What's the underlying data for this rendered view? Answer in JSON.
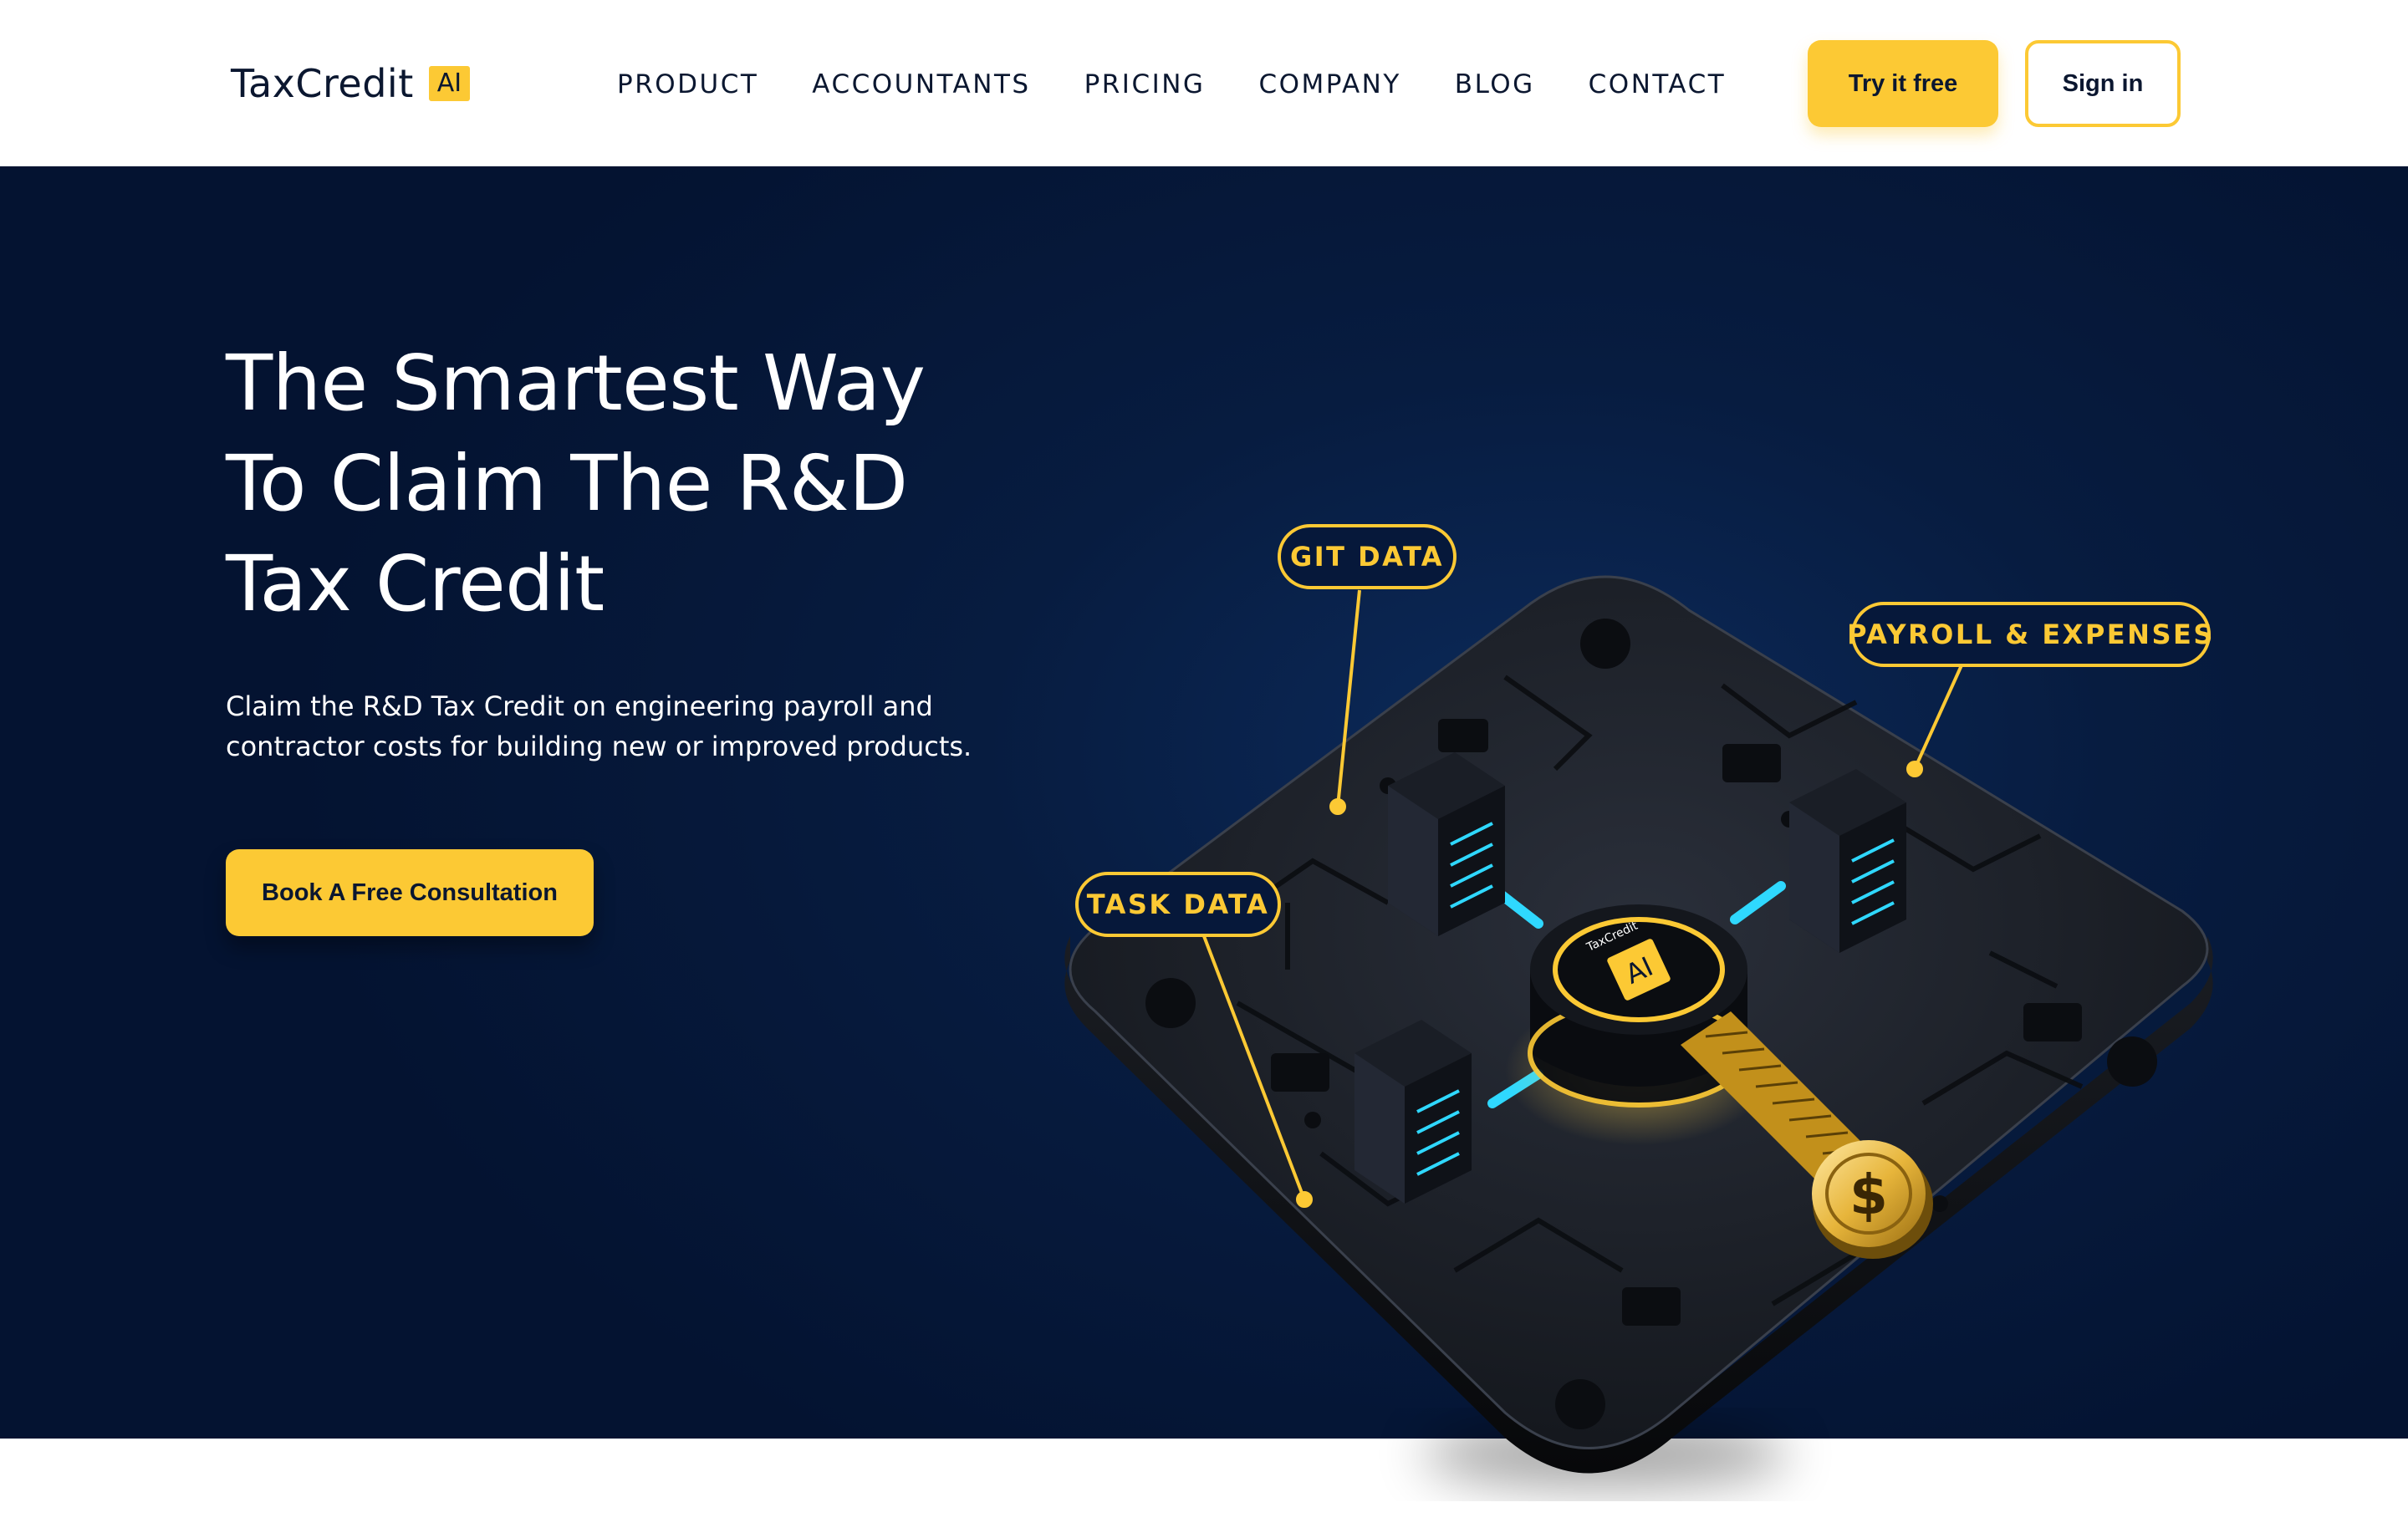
{
  "header": {
    "logo_text": "TaxCredit",
    "logo_badge": "AI",
    "nav": [
      "PRODUCT",
      "ACCOUNTANTS",
      "PRICING",
      "COMPANY",
      "BLOG",
      "CONTACT"
    ],
    "try_label": "Try it free",
    "signin_label": "Sign in"
  },
  "hero": {
    "title_lines": [
      "The Smartest Way",
      "To Claim The R&D",
      "Tax Credit"
    ],
    "subtitle_lines": [
      "Claim the R&D Tax Credit on engineering payroll and",
      "contractor costs for building new or improved products."
    ],
    "cta_label": "Book A Free Consultation"
  },
  "illustration": {
    "callouts": {
      "git": "GIT DATA",
      "payroll": "PAYROLL & EXPENSES",
      "task": "TASK DATA"
    },
    "chip_brand": "TaxCredit",
    "chip_badge": "AI",
    "coin_symbol": "$"
  },
  "colors": {
    "accent": "#fcc934",
    "navy": "#0b1730",
    "hero_bg": "#061a3d",
    "glow": "#2fd8ff"
  }
}
